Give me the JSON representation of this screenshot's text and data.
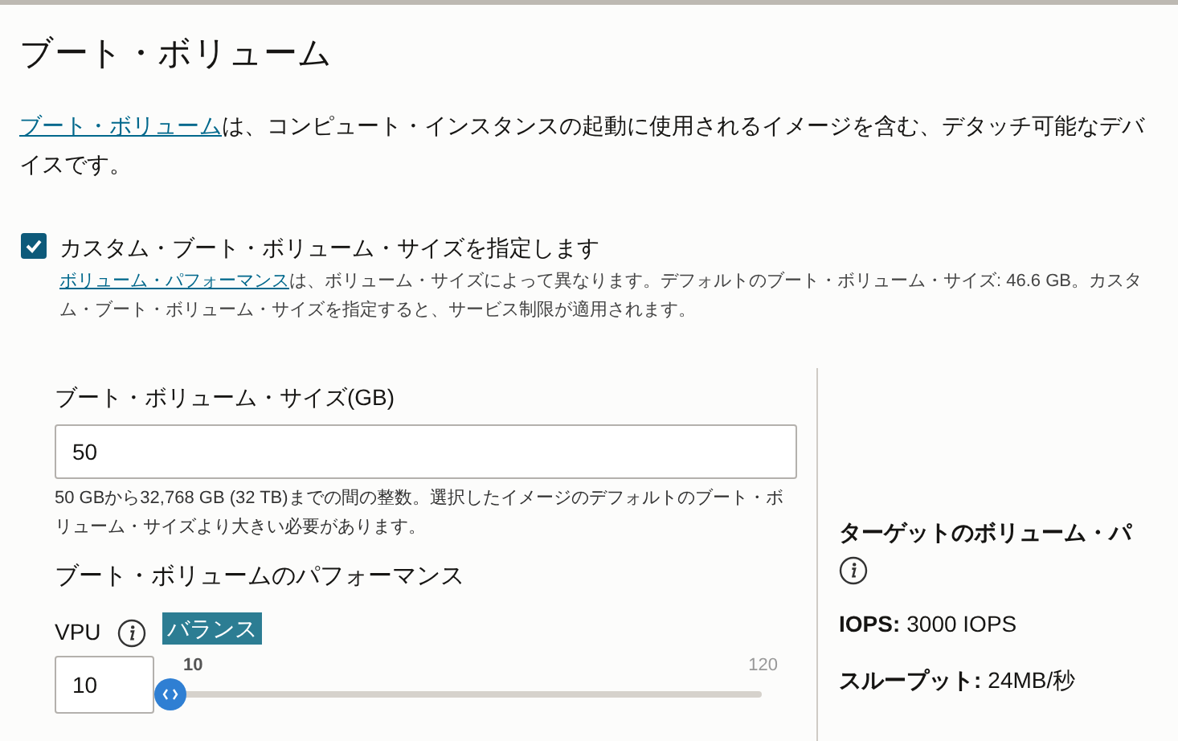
{
  "title": "ブート・ボリューム",
  "description": {
    "link": "ブート・ボリューム",
    "text": "は、コンピュート・インスタンスの起動に使用されるイメージを含む、デタッチ可能なデバイスです。"
  },
  "custom_size": {
    "label": "カスタム・ブート・ボリューム・サイズを指定します",
    "checked": true,
    "help_link": "ボリューム・パフォーマンス",
    "help_text": "は、ボリューム・サイズによって異なります。デフォルトのブート・ボリューム・サイズ: 46.6 GB。カスタム・ブート・ボリューム・サイズを指定すると、サービス制限が適用されます。"
  },
  "size_field": {
    "label": "ブート・ボリューム・サイズ(GB)",
    "value": "50",
    "hint": "50 GBから32,768 GB (32 TB)までの間の整数。選択したイメージのデフォルトのブート・ボリューム・サイズより大きい必要があります。"
  },
  "performance": {
    "heading": "ブート・ボリュームのパフォーマンス",
    "vpu_label": "VPU",
    "vpu_value": "10",
    "slider": {
      "tooltip": "バランス",
      "min": "10",
      "max": "120",
      "level": 0
    }
  },
  "target": {
    "heading": "ターゲットのボリューム・パ",
    "stats": [
      {
        "label": "IOPS:",
        "value": "3000 IOPS"
      },
      {
        "label": "スループット:",
        "value": "24MB/秒"
      }
    ]
  }
}
